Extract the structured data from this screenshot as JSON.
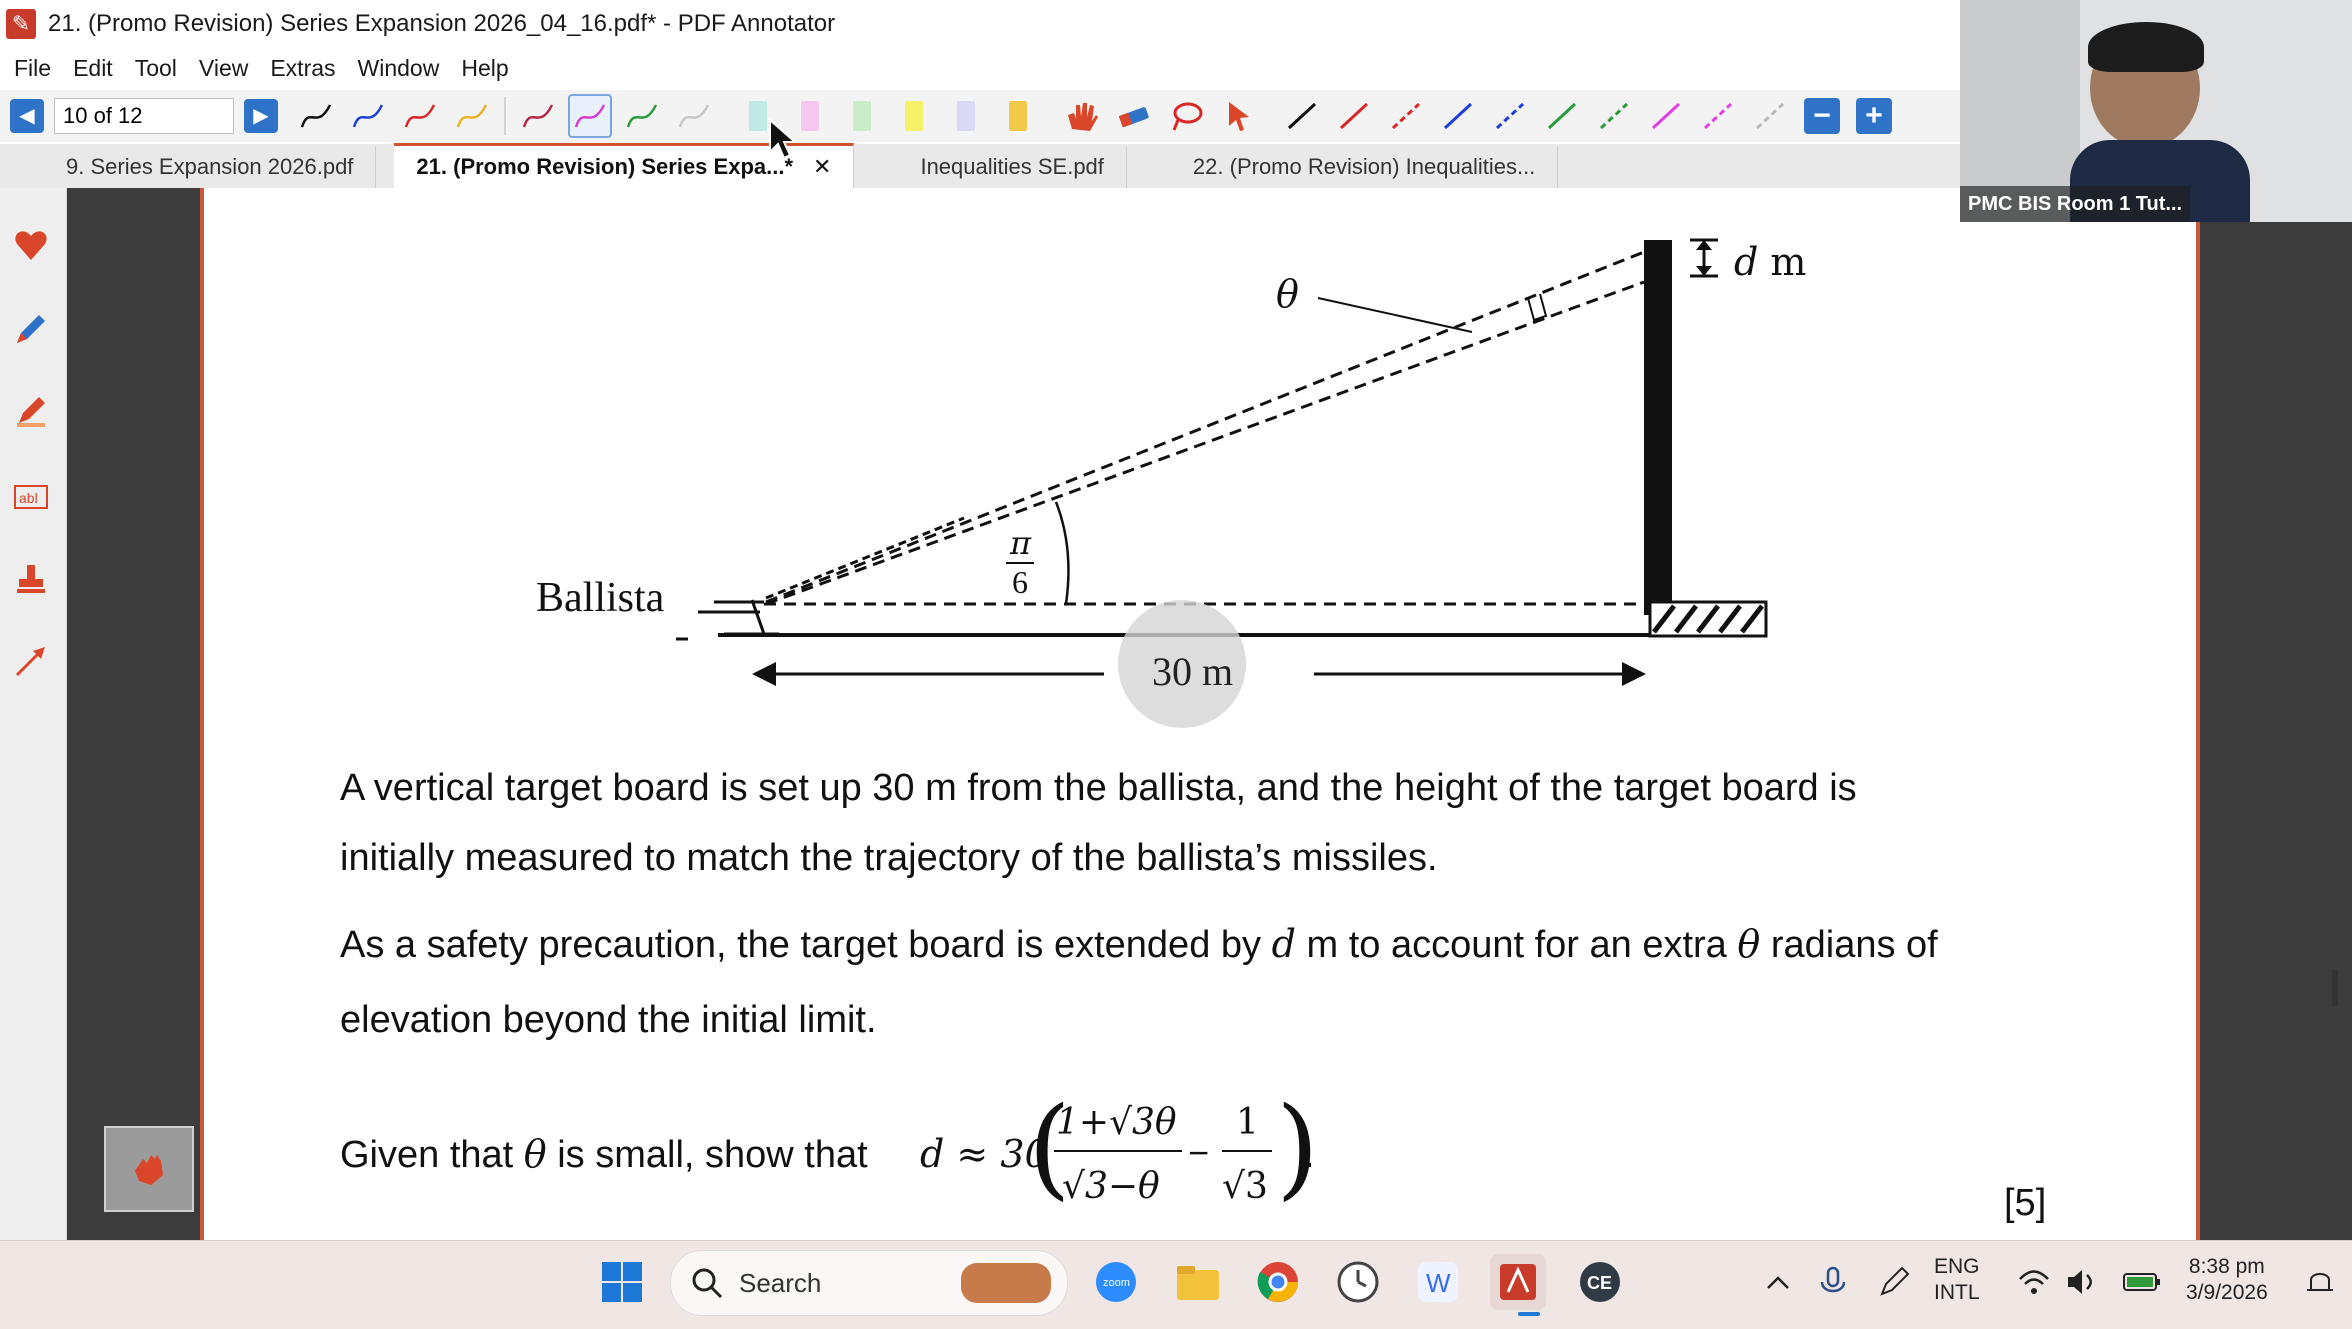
{
  "window": {
    "title": "21. (Promo Revision) Series Expansion 2026_04_16.pdf* - PDF Annotator"
  },
  "menu": [
    "File",
    "Edit",
    "Tool",
    "View",
    "Extras",
    "Window",
    "Help"
  ],
  "toolbar": {
    "page_indicator": "10 of 12",
    "pen_colors": [
      "#111111",
      "#1f3fd6",
      "#d62828",
      "#e8b22a",
      "#b02a4a",
      "#d43fd0",
      "#2a9a3a",
      "#c8c8c8"
    ],
    "highlighter_colors": [
      "#bfe9e4",
      "#f5c8ef",
      "#c8ecc8",
      "#f5f26a",
      "#d9d9f5",
      "#f3c94a"
    ],
    "line_colors": [
      "#111111",
      "#d62828",
      "#d62828",
      "#1f3fd6",
      "#1f3fd6",
      "#2a9a3a",
      "#2a9a3a",
      "#e040e0",
      "#e040e0",
      "#bbbbbb"
    ]
  },
  "tabs": [
    {
      "label": "9. Series Expansion 2026.pdf",
      "active": false
    },
    {
      "label": "21. (Promo Revision) Series Expa...*",
      "active": true
    },
    {
      "label": "Inequalities SE.pdf",
      "active": false
    },
    {
      "label": "22. (Promo Revision) Inequalities...",
      "active": false
    }
  ],
  "sidebar_icons": [
    "favorites-icon",
    "pen-icon",
    "highlighter-icon",
    "text-box-icon",
    "stamp-icon",
    "arrow-icon"
  ],
  "webcam": {
    "label": "PMC BIS Room 1 Tut..."
  },
  "diagram": {
    "ballista_label": "Ballista",
    "theta": "θ",
    "d_label": "d",
    "d_unit": "m",
    "angle_num": "π",
    "angle_den": "6",
    "distance_label": "30 m"
  },
  "content": {
    "para1_line1": "A vertical target board is set up 30 m from the ballista, and the height of the target board is",
    "para1_line2": "initially measured to match the trajectory of the ballista’s missiles.",
    "para2_a": "As a safety precaution, the target board is extended by",
    "para2_d": "d",
    "para2_b": "m to account for an extra",
    "para2_theta": "θ",
    "para2_c": "radians of",
    "para2_line2": "elevation beyond the initial limit.",
    "q_a": "Given that",
    "q_theta": "θ",
    "q_b": "is small, show that",
    "formula_lhs": "d ≈ 30",
    "frac1_num": "1+√3θ",
    "frac1_den": "√3−θ",
    "frac2_num": "1",
    "frac2_den": "√3",
    "marks": "[5]"
  },
  "taskbar": {
    "search_placeholder": "Search",
    "lang_top": "ENG",
    "lang_bottom": "INTL",
    "time": "8:38 pm",
    "date": "3/9/2026"
  }
}
